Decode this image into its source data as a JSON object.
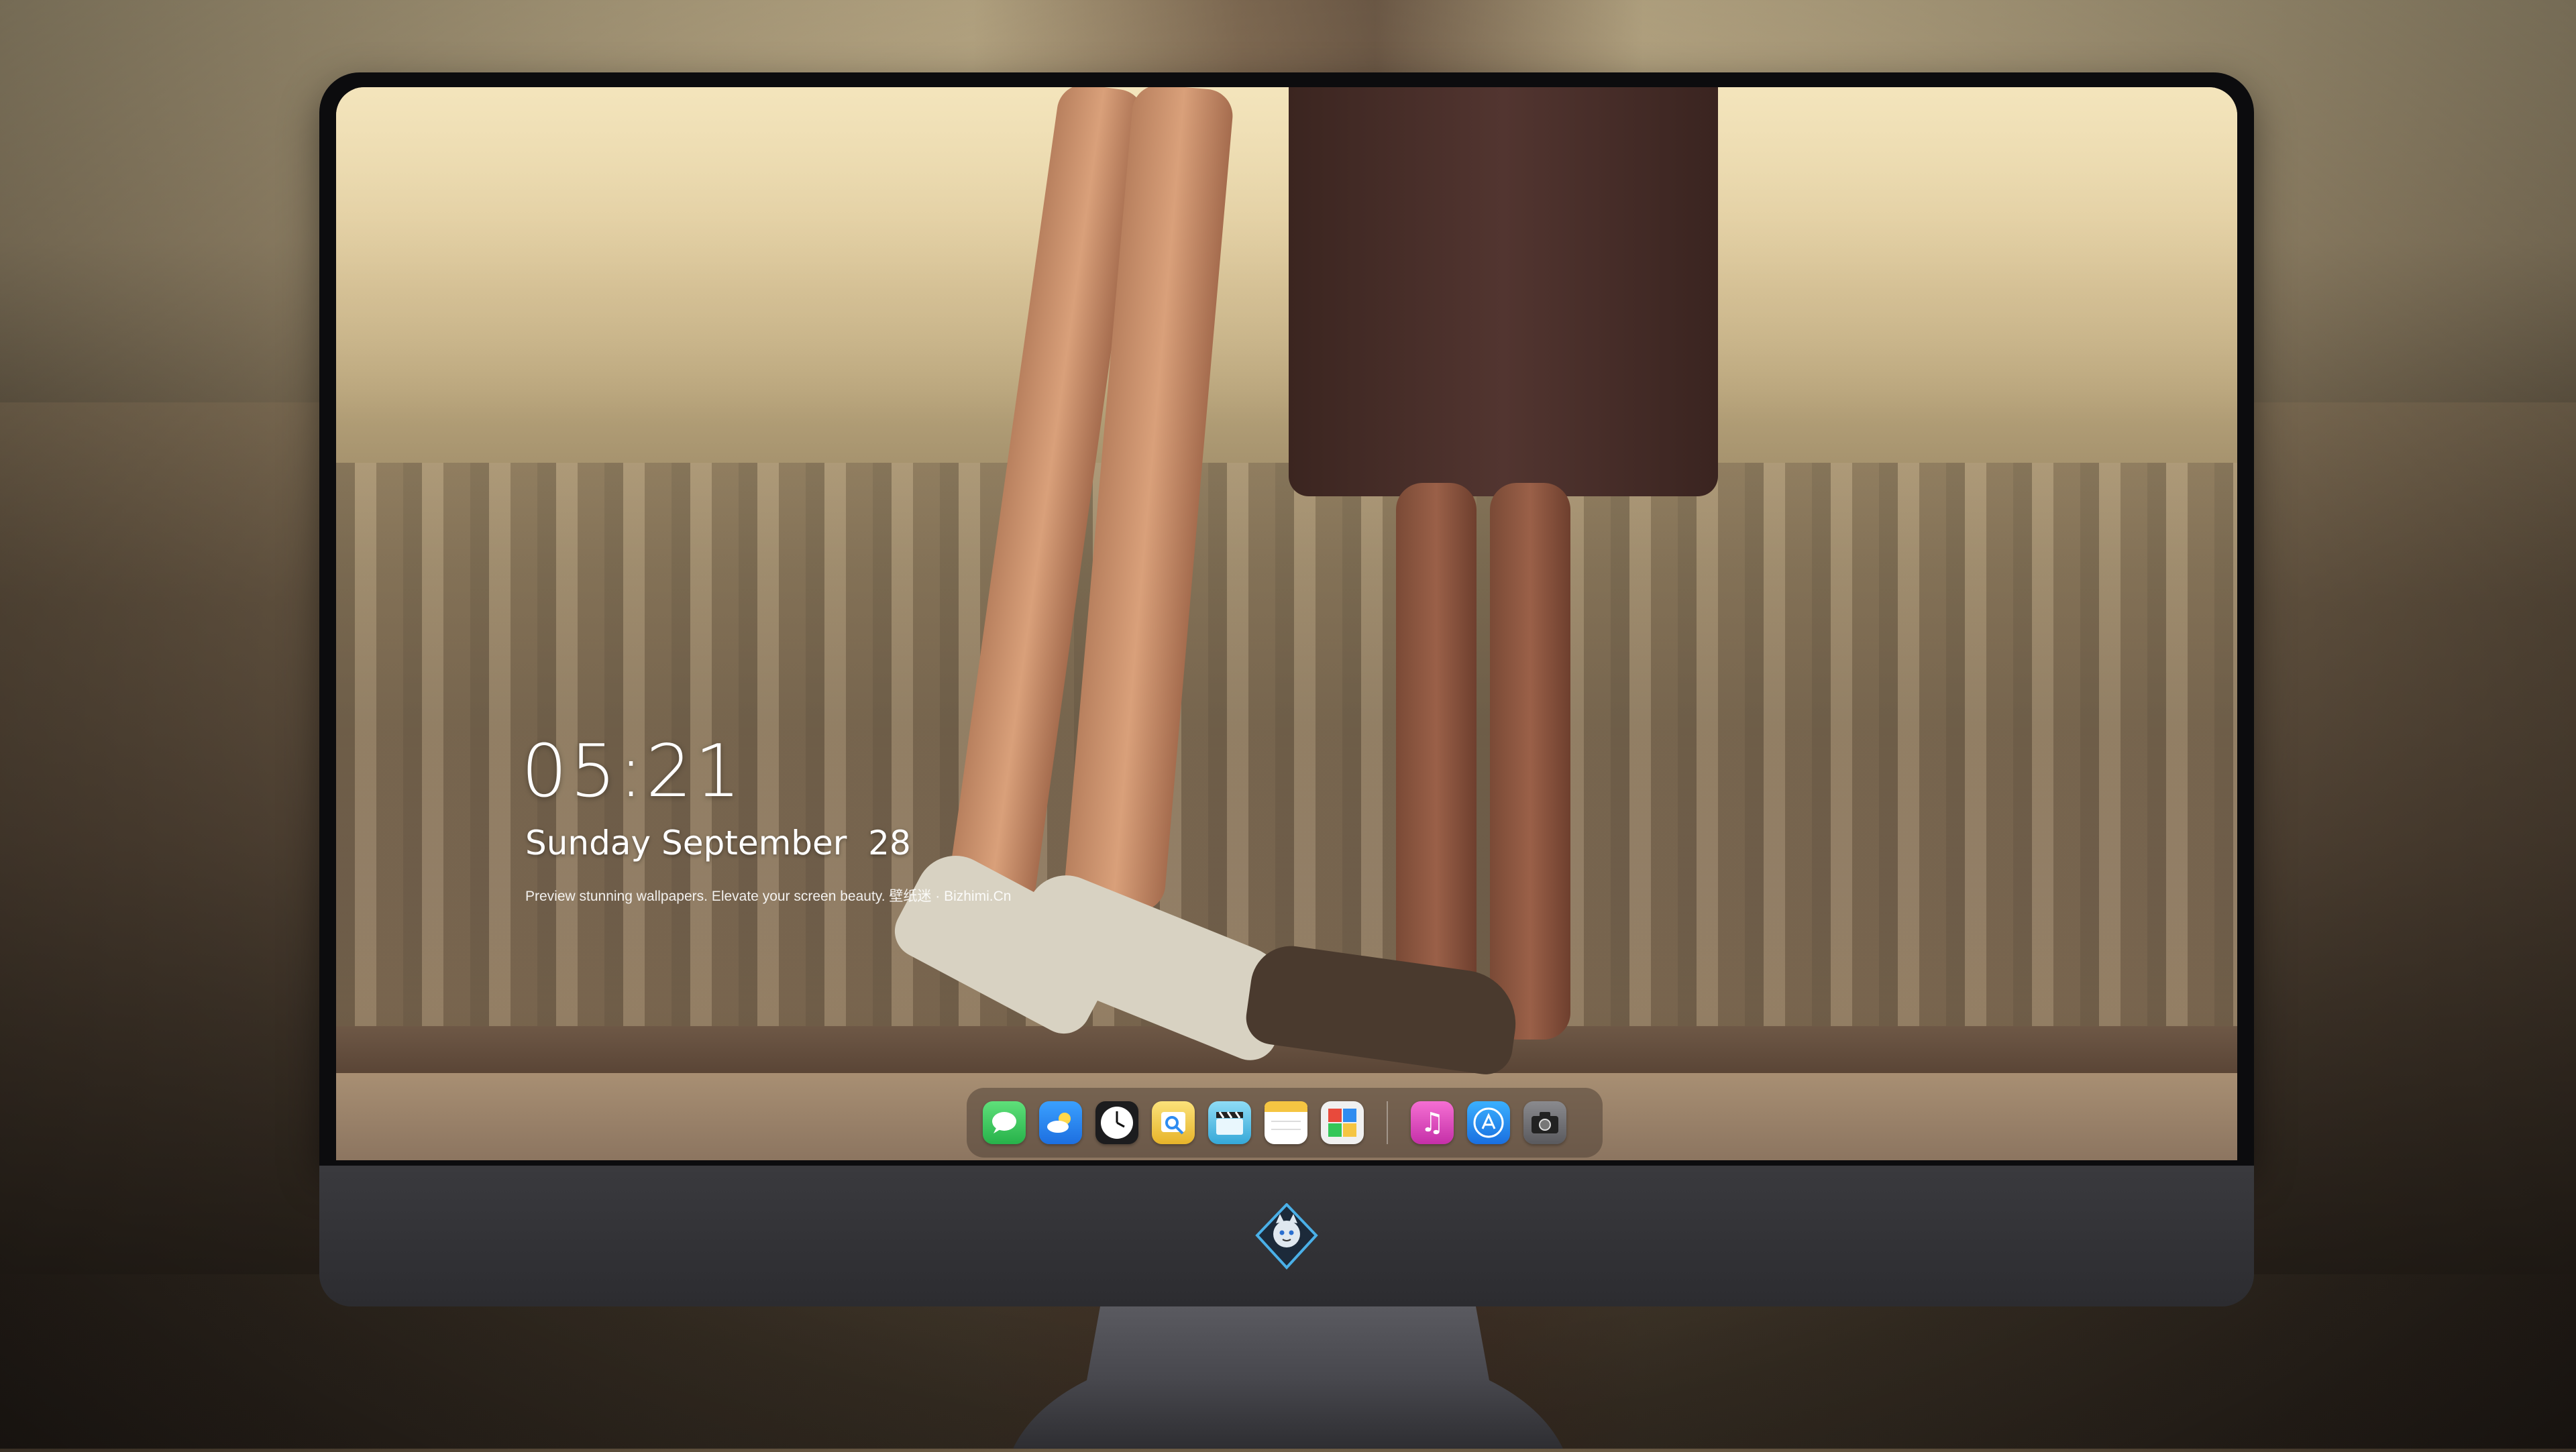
{
  "lockscreen": {
    "time": "05:21",
    "date": "Sunday September  28",
    "tagline": "Preview stunning wallpapers. Elevate your screen beauty. 壁纸迷 · Bizhimi.Cn"
  },
  "dock": {
    "apps": [
      {
        "name": "messages-icon",
        "color": "#34c759"
      },
      {
        "name": "weather-icon",
        "color": "#2f8cf0"
      },
      {
        "name": "clock-icon",
        "color": "#1c1c1e"
      },
      {
        "name": "preview-icon",
        "color": "#f2c12e"
      },
      {
        "name": "claquette-icon",
        "color": "#48b8e8"
      },
      {
        "name": "notes-icon",
        "color": "#f5c542"
      },
      {
        "name": "photo-booth-icon",
        "color": "#f0f0f0"
      },
      {
        "name": "music-icon",
        "color": "#e94fc1"
      },
      {
        "name": "app-store-icon",
        "color": "#1a8cff"
      },
      {
        "name": "camera-icon",
        "color": "#6e6e72"
      }
    ]
  },
  "colors": {
    "bezel": "#0c0c0e",
    "chin": "#2e2e32",
    "dock_bg": "rgba(80,66,54,0.55)"
  }
}
